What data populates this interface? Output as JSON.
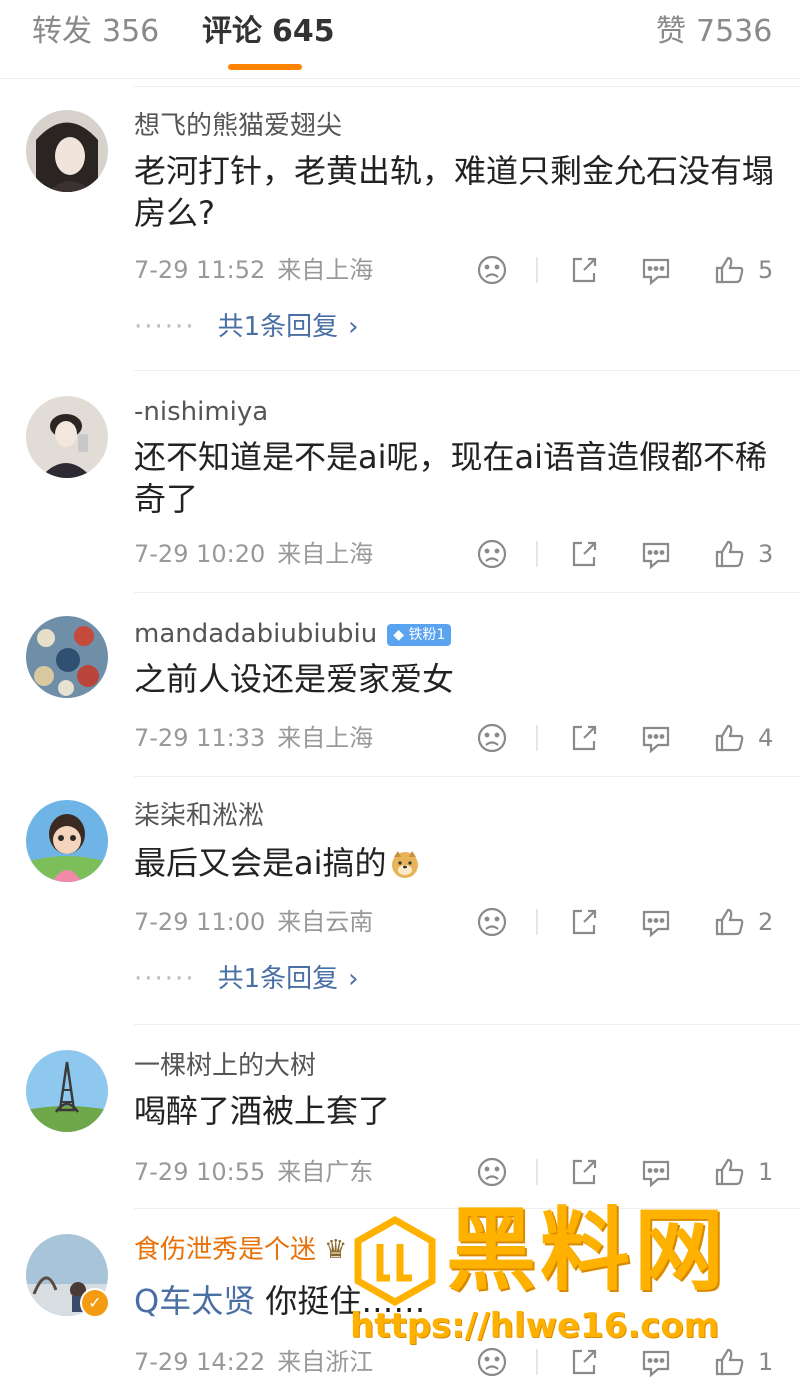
{
  "tabs": {
    "repost": {
      "label": "转发",
      "count": "356"
    },
    "comment": {
      "label": "评论",
      "count": "645"
    },
    "like": {
      "label": "赞",
      "count": "7536"
    }
  },
  "comments": [
    {
      "username": "想飞的熊猫爱翅尖",
      "content": "老河打针，老黄出轨，难道只剩金允石没有塌房么?",
      "time": "7-29 11:52",
      "location": "来自上海",
      "likes": "5",
      "reply_text": "共1条回复"
    },
    {
      "username": "-nishimiya",
      "content": "还不知道是不是ai呢，现在ai语音造假都不稀奇了",
      "time": "7-29 10:20",
      "location": "来自上海",
      "likes": "3"
    },
    {
      "username": "mandadabiubiubiu",
      "badge": "铁粉1",
      "content": "之前人设还是爱家爱女",
      "time": "7-29 11:33",
      "location": "来自上海",
      "likes": "4"
    },
    {
      "username": "柒柒和淞淞",
      "content": "最后又会是ai搞的",
      "time": "7-29 11:00",
      "location": "来自云南",
      "likes": "2",
      "reply_text": "共1条回复"
    },
    {
      "username": "一棵树上的大树",
      "content": "喝醉了酒被上套了",
      "time": "7-29 10:55",
      "location": "来自广东",
      "likes": "1"
    },
    {
      "username": "食伤泄秀是个迷",
      "mention": "Q车太贤",
      "content": "你挺住……",
      "time": "7-29 14:22",
      "location": "来自浙江",
      "likes": "1"
    }
  ],
  "watermark": {
    "title": "黑料网",
    "url": "https://hlwe16.com"
  },
  "colors": {
    "accent": "#ff8200",
    "link": "#4a6fa5",
    "muted": "#999999",
    "watermark": "#ffb100"
  },
  "icons": {
    "dislike": "frown-face-icon",
    "share": "share-icon",
    "comment": "comment-bubble-icon",
    "like": "thumbs-up-icon"
  }
}
